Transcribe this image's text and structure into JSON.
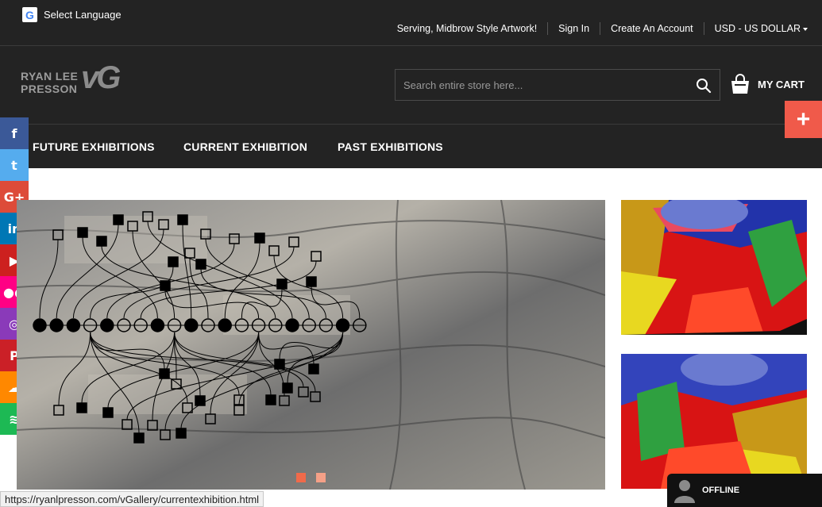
{
  "language": {
    "label": "Select Language"
  },
  "toplinks": {
    "tagline": "Serving, Midbrow Style Artwork!",
    "sign_in": "Sign In",
    "create_account": "Create An Account",
    "currency": "USD - US DOLLAR"
  },
  "logo": {
    "line1": "RYAN LEE",
    "line2": "PRESSON",
    "mark": "vG"
  },
  "search": {
    "placeholder": "Search entire store here..."
  },
  "cart": {
    "label": "MY CART"
  },
  "fab": {
    "label": "+"
  },
  "nav": {
    "items": [
      {
        "label": "FUTURE EXHIBITIONS"
      },
      {
        "label": "CURRENT EXHIBITION"
      },
      {
        "label": "PAST EXHIBITIONS"
      }
    ]
  },
  "social": [
    {
      "name": "facebook-icon",
      "glyph": "f",
      "color": "#3b5998"
    },
    {
      "name": "twitter-icon",
      "glyph": "t",
      "color": "#55acee"
    },
    {
      "name": "google-plus-icon",
      "glyph": "G+",
      "color": "#dd4b39"
    },
    {
      "name": "linkedin-icon",
      "glyph": "in",
      "color": "#0077b5"
    },
    {
      "name": "youtube-icon",
      "glyph": "▶",
      "color": "#cd201f"
    },
    {
      "name": "flickr-icon",
      "glyph": "●●",
      "color": "#ff0084"
    },
    {
      "name": "instagram-icon",
      "glyph": "◎",
      "color": "#8a3ab9"
    },
    {
      "name": "pinterest-icon",
      "glyph": "P",
      "color": "#cb2027"
    },
    {
      "name": "soundcloud-icon",
      "glyph": "☁",
      "color": "#ff8800"
    },
    {
      "name": "spotify-icon",
      "glyph": "≋",
      "color": "#1db954"
    }
  ],
  "slider": {
    "slides": 2,
    "active": 1
  },
  "status_url": "https://ryanlpresson.com/vGallery/currentexhibition.html",
  "chat": {
    "label": "OFFLINE"
  },
  "colors": {
    "header_bg": "#232323",
    "accent": "#f05a4a"
  }
}
